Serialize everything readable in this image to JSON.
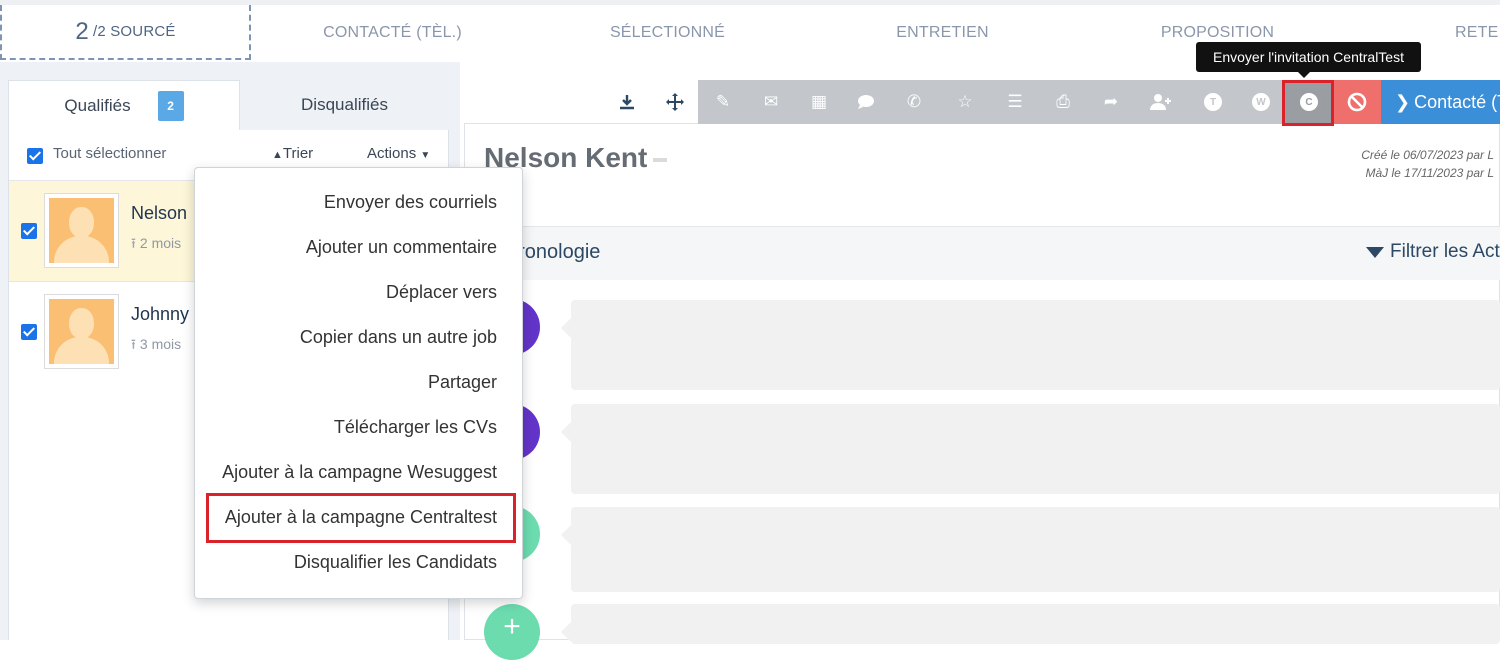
{
  "stages": {
    "active_count": "2",
    "active_label": "/2 SOURCÉ",
    "items": [
      "CONTACTÉ (TÈL.)",
      "SÉLECTIONNÉ",
      "ENTRETIEN",
      "PROPOSITION",
      "RETE"
    ]
  },
  "tabs": {
    "qualified": "Qualifiés",
    "qualified_count": "2",
    "disqualified": "Disqualifiés"
  },
  "list": {
    "select_all": "Tout sélectionner",
    "sort": "Trier",
    "actions": "Actions"
  },
  "candidates": [
    {
      "name": "Nelson",
      "meta": "2 mois"
    },
    {
      "name": "Johnny",
      "meta": "3 mois"
    }
  ],
  "dropdown": [
    "Envoyer des courriels",
    "Ajouter un commentaire",
    "Déplacer vers",
    "Copier dans un autre job",
    "Partager",
    "Télécharger les CVs",
    "Ajouter à la campagne Wesuggest",
    "Ajouter à la campagne Centraltest",
    "Disqualifier les Candidats"
  ],
  "toolbar": {
    "tooltip": "Envoyer l'invitation CentralTest",
    "contact_button": "Contacté (T",
    "circle_t": "T",
    "circle_w": "W",
    "circle_c": "C"
  },
  "profile": {
    "name": "Nelson Kent",
    "created": "Créé le 06/07/2023 par L",
    "updated": "MàJ le 17/11/2023 par L"
  },
  "timeline": {
    "title": "hronologie",
    "filter": "Filtrer les Act"
  },
  "colors": {
    "accent_blue": "#3b8fd8",
    "badge_blue": "#5aa9e6",
    "danger_red": "#ef6f6c",
    "highlight_red": "#d9222a",
    "purple": "#6334c9",
    "mint": "#6cdcaf"
  }
}
